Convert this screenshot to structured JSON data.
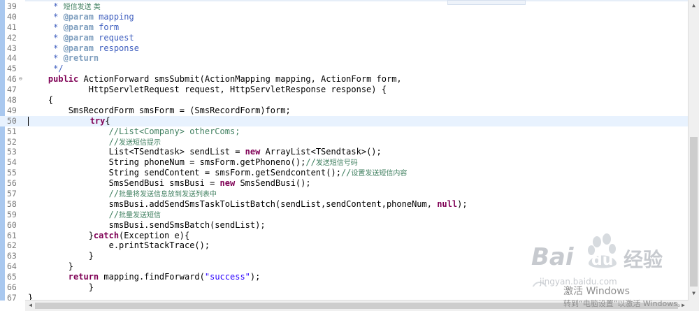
{
  "editor": {
    "lines": [
      {
        "n": "39",
        "segs": [
          {
            "c": "cm",
            "t": "     * "
          },
          {
            "c": "cn",
            "t": "短信发送 类"
          }
        ]
      },
      {
        "n": "40",
        "segs": [
          {
            "c": "cm",
            "t": "     * "
          },
          {
            "c": "tag",
            "t": "@param"
          },
          {
            "c": "cm",
            "t": " mapping"
          }
        ]
      },
      {
        "n": "41",
        "segs": [
          {
            "c": "cm",
            "t": "     * "
          },
          {
            "c": "tag",
            "t": "@param"
          },
          {
            "c": "cm",
            "t": " form"
          }
        ]
      },
      {
        "n": "42",
        "segs": [
          {
            "c": "cm",
            "t": "     * "
          },
          {
            "c": "tag",
            "t": "@param"
          },
          {
            "c": "cm",
            "t": " request"
          }
        ]
      },
      {
        "n": "43",
        "segs": [
          {
            "c": "cm",
            "t": "     * "
          },
          {
            "c": "tag",
            "t": "@param"
          },
          {
            "c": "cm",
            "t": " response"
          }
        ]
      },
      {
        "n": "44",
        "segs": [
          {
            "c": "cm",
            "t": "     * "
          },
          {
            "c": "tag",
            "t": "@return"
          }
        ]
      },
      {
        "n": "45",
        "segs": [
          {
            "c": "cm",
            "t": "     */"
          }
        ]
      },
      {
        "n": "46",
        "fold": true,
        "segs": [
          {
            "c": "",
            "t": "    "
          },
          {
            "c": "kw",
            "t": "public"
          },
          {
            "c": "",
            "t": " ActionForward smsSubmit(ActionMapping mapping, ActionForm form,"
          }
        ]
      },
      {
        "n": "47",
        "segs": [
          {
            "c": "",
            "t": "            HttpServletRequest request, HttpServletResponse response) {"
          }
        ]
      },
      {
        "n": "48",
        "segs": [
          {
            "c": "",
            "t": "    {"
          }
        ]
      },
      {
        "n": "49",
        "segs": [
          {
            "c": "",
            "t": "        SmsRecordForm smsForm = (SmsRecordForm)form;"
          }
        ]
      },
      {
        "n": "50",
        "current": true,
        "segs": [
          {
            "c": "",
            "t": "            "
          },
          {
            "c": "kw",
            "t": "try"
          },
          {
            "c": "",
            "t": "{"
          }
        ]
      },
      {
        "n": "51",
        "segs": [
          {
            "c": "",
            "t": "                "
          },
          {
            "c": "lc",
            "t": "//List<Company> otherComs;"
          }
        ]
      },
      {
        "n": "52",
        "segs": [
          {
            "c": "",
            "t": "                "
          },
          {
            "c": "lc",
            "t": "//"
          },
          {
            "c": "cn",
            "t": "发送短信提示"
          }
        ]
      },
      {
        "n": "53",
        "segs": [
          {
            "c": "",
            "t": "                List<TSendtask> sendList = "
          },
          {
            "c": "kw",
            "t": "new"
          },
          {
            "c": "",
            "t": " ArrayList<TSendtask>();"
          }
        ]
      },
      {
        "n": "54",
        "segs": [
          {
            "c": "",
            "t": "                String phoneNum = smsForm.getPhoneno();"
          },
          {
            "c": "lc",
            "t": "//"
          },
          {
            "c": "cn",
            "t": "发送短信号码"
          }
        ]
      },
      {
        "n": "55",
        "segs": [
          {
            "c": "",
            "t": "                String sendContent = smsForm.getSendcontent();"
          },
          {
            "c": "lc",
            "t": "//"
          },
          {
            "c": "cn",
            "t": "设置发送短信内容"
          }
        ]
      },
      {
        "n": "56",
        "segs": [
          {
            "c": "",
            "t": "                SmsSendBusi smsBusi = "
          },
          {
            "c": "kw",
            "t": "new"
          },
          {
            "c": "",
            "t": " SmsSendBusi();"
          }
        ]
      },
      {
        "n": "57",
        "segs": [
          {
            "c": "",
            "t": "                "
          },
          {
            "c": "lc",
            "t": "//"
          },
          {
            "c": "cn",
            "t": "批量将发送信息放到发送列表中"
          }
        ]
      },
      {
        "n": "58",
        "segs": [
          {
            "c": "",
            "t": "                smsBusi.addSendSmsTaskToListBatch(sendList,sendContent,phoneNum, "
          },
          {
            "c": "kw",
            "t": "null"
          },
          {
            "c": "",
            "t": ");"
          }
        ]
      },
      {
        "n": "59",
        "segs": [
          {
            "c": "",
            "t": "                "
          },
          {
            "c": "lc",
            "t": "//"
          },
          {
            "c": "cn",
            "t": "批量发送短信"
          }
        ]
      },
      {
        "n": "60",
        "segs": [
          {
            "c": "",
            "t": "                smsBusi.sendSmsBatch(sendList);"
          }
        ]
      },
      {
        "n": "61",
        "segs": [
          {
            "c": "",
            "t": "            }"
          },
          {
            "c": "kw",
            "t": "catch"
          },
          {
            "c": "",
            "t": "(Exception e){"
          }
        ]
      },
      {
        "n": "62",
        "segs": [
          {
            "c": "",
            "t": "                e.printStackTrace();"
          }
        ]
      },
      {
        "n": "63",
        "segs": [
          {
            "c": "",
            "t": "            }"
          }
        ]
      },
      {
        "n": "64",
        "segs": [
          {
            "c": "",
            "t": "        }"
          }
        ]
      },
      {
        "n": "65",
        "segs": [
          {
            "c": "",
            "t": "        "
          },
          {
            "c": "kw",
            "t": "return"
          },
          {
            "c": "",
            "t": " mapping.findForward("
          },
          {
            "c": "str",
            "t": "\"success\""
          },
          {
            "c": "",
            "t": ");"
          }
        ]
      },
      {
        "n": "66",
        "segs": [
          {
            "c": "",
            "t": "            }"
          }
        ]
      },
      {
        "n": "67",
        "segs": [
          {
            "c": "",
            "t": "}"
          }
        ]
      }
    ]
  },
  "watermark": {
    "brand": "Bai",
    "brand2": "du",
    "brand_cn": "经验",
    "site": "jingyan.baidu.com"
  },
  "windows_activation": {
    "title": "激活 Windows",
    "subtitle": "转到“电脑设置”以激活 Windows。"
  },
  "colors": {
    "keyword": "#7f0055",
    "javadoc": "#3f5fbf",
    "javadoc_tag": "#7f9fbf",
    "line_comment": "#3f7f5f",
    "string": "#2a00ff",
    "current_line": "#e8f2fe",
    "gutter_bar": "#a9c8ef"
  }
}
